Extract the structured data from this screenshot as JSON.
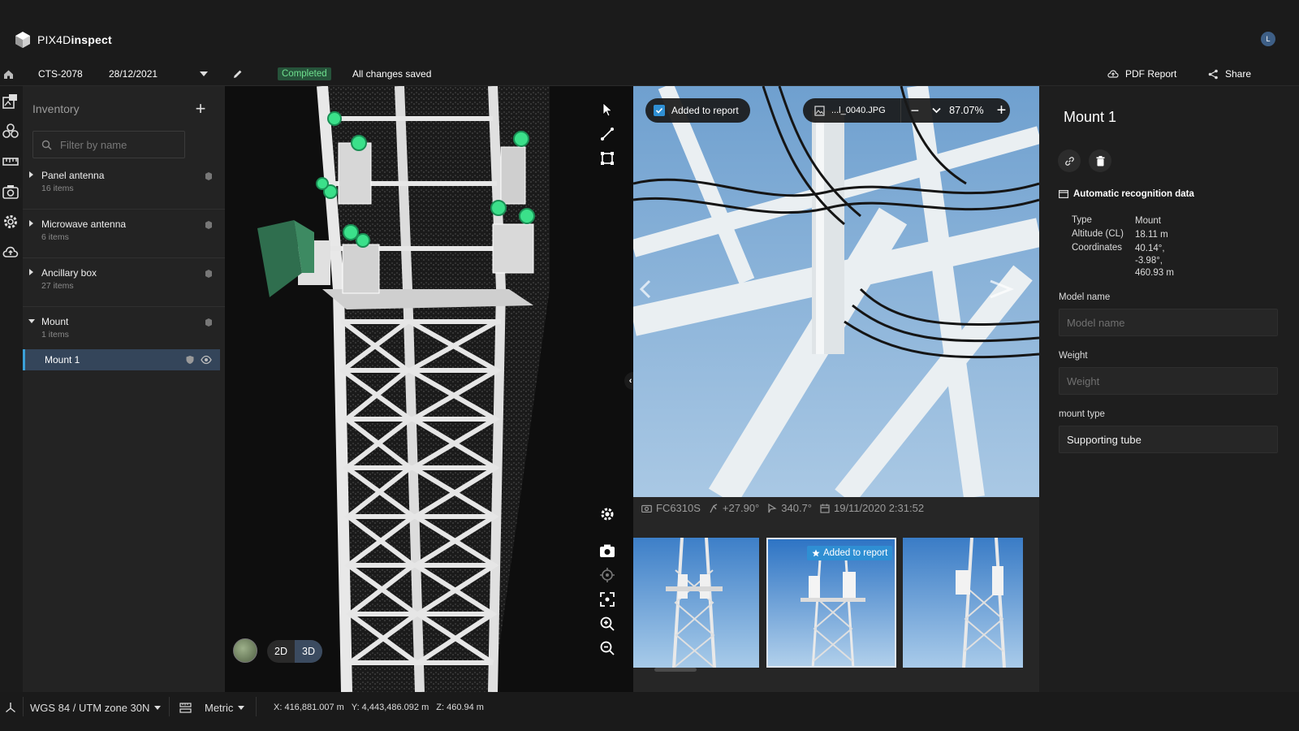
{
  "app": {
    "brand_light": "PIX4D",
    "brand_bold": "inspect",
    "avatar_initial": "L"
  },
  "toolbar": {
    "project_id": "CTS-2078",
    "date": "28/12/2021",
    "status_badge": "Completed",
    "save_status": "All changes saved",
    "pdf_report_label": "PDF Report",
    "share_label": "Share"
  },
  "inventory": {
    "title": "Inventory",
    "filter_placeholder": "Filter by name",
    "categories": [
      {
        "name": "Panel antenna",
        "count": "16 items",
        "expanded": false
      },
      {
        "name": "Microwave antenna",
        "count": "6 items",
        "expanded": false
      },
      {
        "name": "Ancillary box",
        "count": "27 items",
        "expanded": false
      },
      {
        "name": "Mount",
        "count": "1 items",
        "expanded": true
      }
    ],
    "selected_item": "Mount 1"
  },
  "viewer3d": {
    "mode_2d": "2D",
    "mode_3d": "3D",
    "active_mode": "3D"
  },
  "photo": {
    "added_to_report": "Added to report",
    "filename": "...l_0040.JPG",
    "zoom": "87.07%",
    "camera": "FC6310S",
    "pitch": "+27.90°",
    "heading": "340.7°",
    "datetime": "19/11/2020 2:31:52",
    "thumb_added_label": "Added to report"
  },
  "details": {
    "title": "Mount 1",
    "auto_recognition_header": "Automatic recognition data",
    "type_label": "Type",
    "type_value": "Mount",
    "altitude_label": "Altitude (CL)",
    "altitude_value": "18.11 m",
    "coordinates_label": "Coordinates",
    "coord_1": "40.14°,",
    "coord_2": "-3.98°,",
    "coord_3": "460.93 m",
    "model_name_label": "Model name",
    "model_name_placeholder": "Model name",
    "weight_label": "Weight",
    "weight_placeholder": "Weight",
    "mount_type_label": "mount type",
    "mount_type_value": "Supporting tube"
  },
  "statusbar": {
    "crs": "WGS 84 / UTM zone 30N",
    "units": "Metric",
    "x": "X: 416,881.007 m",
    "y": "Y: 4,443,486.092 m",
    "z": "Z: 460.94 m"
  },
  "colors": {
    "accent": "#2f8fd3",
    "selected_row": "#34455a",
    "completed_bg": "#26533a",
    "completed_text": "#6fe08f"
  }
}
